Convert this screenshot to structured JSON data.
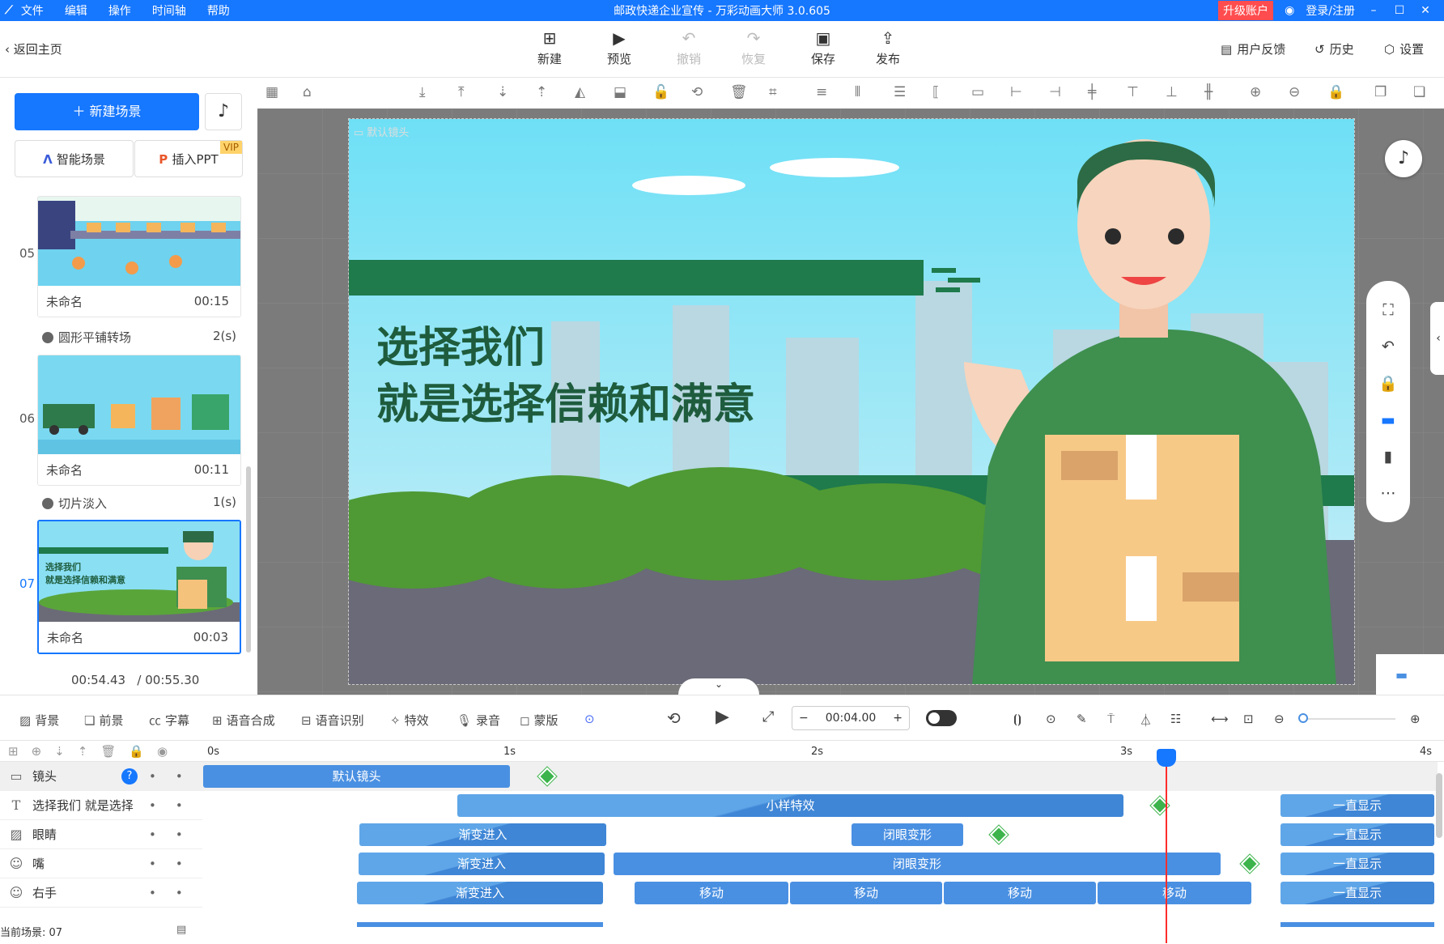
{
  "titlebar": {
    "menu": [
      "文件",
      "编辑",
      "操作",
      "时间轴",
      "帮助"
    ],
    "title": "邮政快递企业宣传 - 万彩动画大师 3.0.605",
    "upgrade": "升级账户",
    "login": "登录/注册"
  },
  "toolbar": {
    "back": "返回主页",
    "buttons": [
      {
        "label": "新建",
        "icon": "new-icon",
        "enabled": true
      },
      {
        "label": "预览",
        "icon": "play-icon",
        "enabled": true
      },
      {
        "label": "撤销",
        "icon": "undo-icon",
        "enabled": false
      },
      {
        "label": "恢复",
        "icon": "redo-icon",
        "enabled": false
      },
      {
        "label": "保存",
        "icon": "save-icon",
        "enabled": true
      },
      {
        "label": "发布",
        "icon": "publish-icon",
        "enabled": true
      }
    ],
    "feedback": "用户反馈",
    "history": "历史",
    "settings": "设置"
  },
  "left": {
    "new_scene": "新建场景",
    "smart_scene": "智能场景",
    "insert_ppt": "插入PPT",
    "vip": "VIP",
    "scenes": [
      {
        "num": "05",
        "name": "未命名",
        "dur": "00:15"
      },
      {
        "num": "06",
        "name": "未命名",
        "dur": "00:11"
      },
      {
        "num": "07",
        "name": "未命名",
        "dur": "00:03"
      }
    ],
    "transitions": [
      {
        "name": "圆形平铺转场",
        "dur": "2(s)"
      },
      {
        "name": "切片淡入",
        "dur": "1(s)"
      }
    ],
    "thumb_text_1": "选择我们",
    "thumb_text_2": "就是选择信赖和满意",
    "time_current": "00:54.43",
    "time_total": "/ 00:55.30"
  },
  "stage": {
    "camera_label": "默认镜头",
    "line1": "选择我们",
    "line2": "就是选择信赖和满意"
  },
  "bottombar": {
    "tools": [
      "背景",
      "前景",
      "字幕",
      "语音合成",
      "语音识别",
      "特效",
      "录音",
      "蒙版"
    ],
    "time": "00:04.00"
  },
  "timeline": {
    "ruler": [
      "0s",
      "1s",
      "2s",
      "3s",
      "4s"
    ],
    "tracks": [
      {
        "name": "镜头",
        "icon": "camera-icon"
      },
      {
        "name": "选择我们  就是选择",
        "icon": "text-icon"
      },
      {
        "name": "眼睛",
        "icon": "image-icon"
      },
      {
        "name": "嘴",
        "icon": "role-icon"
      },
      {
        "name": "右手",
        "icon": "role-icon"
      }
    ],
    "clips": {
      "camera": "默认镜头",
      "text": "小样特效",
      "fade_in": "渐变进入",
      "blink": "闭眼变形",
      "move": "移动",
      "always": "一直显示"
    },
    "current_scene": "当前场景: 07"
  },
  "colors": {
    "accent": "#1677ff",
    "playhead": "#ff2d2d",
    "keyframe": "#3cb44b"
  }
}
